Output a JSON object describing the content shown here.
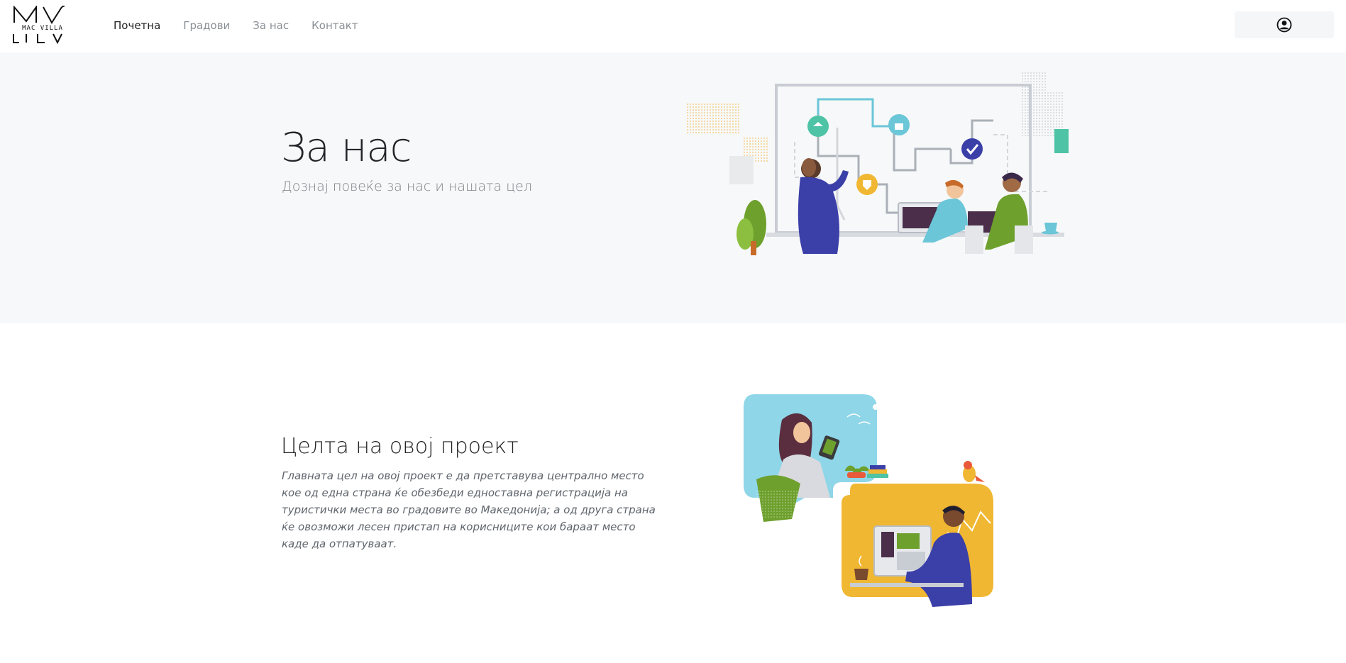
{
  "brand": {
    "logo_text": "MAC VILLA",
    "logo_letters_top": "MV",
    "logo_letters_bottom": "LV"
  },
  "nav": {
    "items": [
      {
        "label": "Почетна",
        "active": true
      },
      {
        "label": "Градови",
        "active": false
      },
      {
        "label": "За нас",
        "active": false
      },
      {
        "label": "Контакт",
        "active": false
      }
    ],
    "user_icon": "user-circle-icon"
  },
  "hero": {
    "title": "За нас",
    "subtitle": "Дознај повеќе за нас и нашата цел"
  },
  "about": {
    "title": "Целта на овој проект",
    "text": "Главната цел на овој проект е да претставува централно место кое од една страна ќе обезбеди едноставна регистрација на туристички места во градовите во Македонија; а од друга страна ќе овозможи лесен пристап на корисниците кои бараат место каде да отпатуваат."
  },
  "colors": {
    "hero_bg": "#f7f8f9",
    "teal": "#4ec3a6",
    "blue": "#3b3fa8",
    "yellow": "#f0b732",
    "sky": "#8ed6e8",
    "green": "#6ea02d"
  }
}
